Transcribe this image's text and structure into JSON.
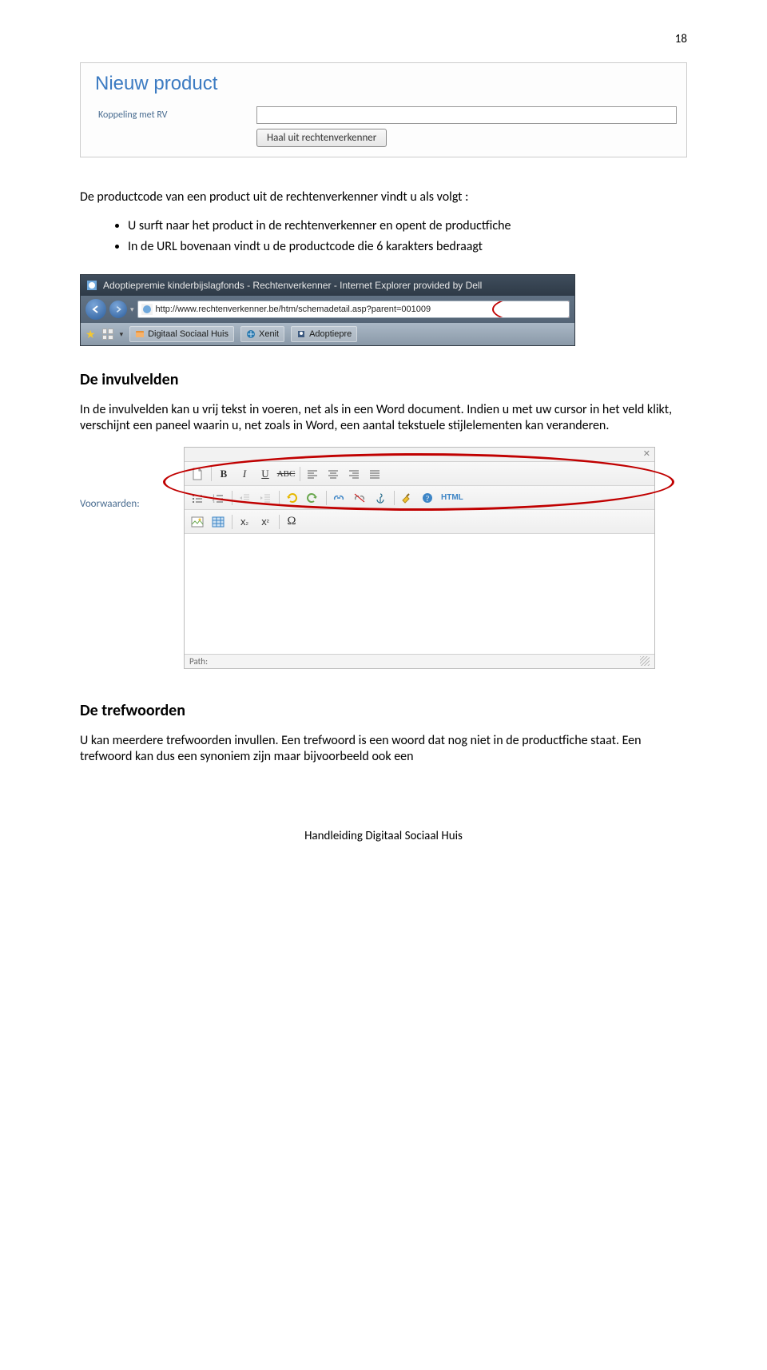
{
  "page_number": "18",
  "form": {
    "title": "Nieuw product",
    "row1_label": "Koppeling met RV",
    "button_label": "Haal uit rechtenverkenner"
  },
  "intro": "De productcode van een product uit de rechtenverkenner vindt u als volgt :",
  "bullets": [
    "U surft naar het product in de rechtenverkenner en opent de productfiche",
    "In de URL bovenaan vindt u de productcode die 6 karakters bedraagt"
  ],
  "ie": {
    "title": "Adoptiepremie kinderbijslagfonds - Rechtenverkenner - Internet Explorer provided by Dell",
    "url": "http://www.rechtenverkenner.be/htm/schemadetail.asp?paren",
    "url_highlight": "t=001009",
    "bm1": "Digitaal Sociaal Huis",
    "bm2": "Xenit",
    "bm3": "Adoptiepre"
  },
  "sec1": {
    "heading": "De invulvelden",
    "para": "In de invulvelden kan u vrij tekst in voeren, net als in een Word document. Indien u met uw cursor in het veld klikt, verschijnt een paneel waarin u, net zoals in Word, een aantal tekstuele stijlelementen kan veranderen."
  },
  "rte": {
    "label": "Voorwaarden:",
    "path_label": "Path:",
    "html_label": "HTML"
  },
  "sec2": {
    "heading": "De trefwoorden",
    "para": "U kan meerdere trefwoorden invullen. Een trefwoord is een woord dat nog niet in de productfiche staat. Een trefwoord kan dus een synoniem zijn maar bijvoorbeeld ook een"
  },
  "footer": "Handleiding Digitaal Sociaal Huis"
}
